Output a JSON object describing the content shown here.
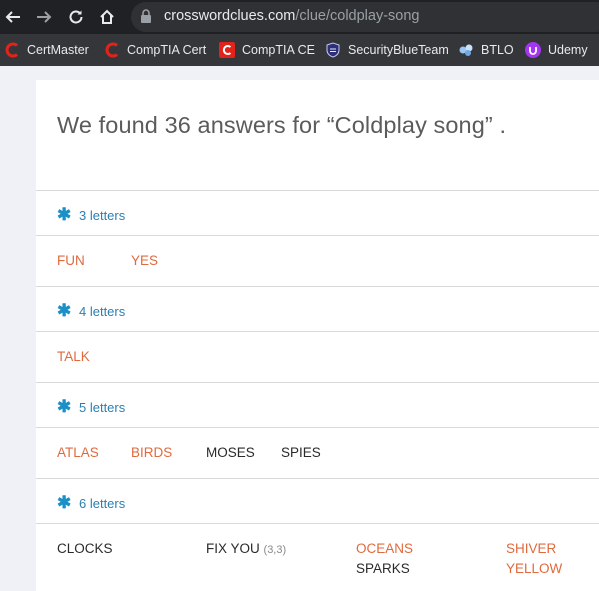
{
  "browser": {
    "url_host": "crosswordclues.com",
    "url_path": "/clue/coldplay-song",
    "bookmarks": [
      {
        "label": "CertMaster",
        "icon": "certmaster-icon"
      },
      {
        "label": "CompTIA Cert",
        "icon": "comptia-icon"
      },
      {
        "label": "CompTIA CE",
        "icon": "comptia-ce-icon"
      },
      {
        "label": "SecurityBlueTeam",
        "icon": "shield-icon"
      },
      {
        "label": "BTLO",
        "icon": "btlo-icon"
      },
      {
        "label": "Udemy",
        "icon": "udemy-icon"
      }
    ]
  },
  "page": {
    "heading": "We found 36 answers for “Coldplay song” .",
    "groups": [
      {
        "label": "3 letters",
        "answers": [
          {
            "word": "FUN",
            "linked": true
          },
          {
            "word": "YES",
            "linked": true
          }
        ]
      },
      {
        "label": "4 letters",
        "answers": [
          {
            "word": "TALK",
            "linked": true
          }
        ]
      },
      {
        "label": "5 letters",
        "answers": [
          {
            "word": "ATLAS",
            "linked": true
          },
          {
            "word": "BIRDS",
            "linked": true
          },
          {
            "word": "MOSES",
            "linked": false
          },
          {
            "word": "SPIES",
            "linked": false
          }
        ]
      },
      {
        "label": "6 letters",
        "answers": [
          {
            "word": "CLOCKS",
            "linked": false
          },
          {
            "word": "FIX YOU",
            "meta": "(3,3)",
            "linked": false
          },
          {
            "word": "OCEANS",
            "linked": true
          },
          {
            "word": "SHIVER",
            "linked": true
          },
          {
            "word": "SPARKS",
            "linked": false
          },
          {
            "word": "YELLOW",
            "linked": true
          }
        ]
      }
    ]
  },
  "colors": {
    "link": "#e06a3e",
    "group_header": "#2b7fb0",
    "star": "#1b8fc6"
  }
}
